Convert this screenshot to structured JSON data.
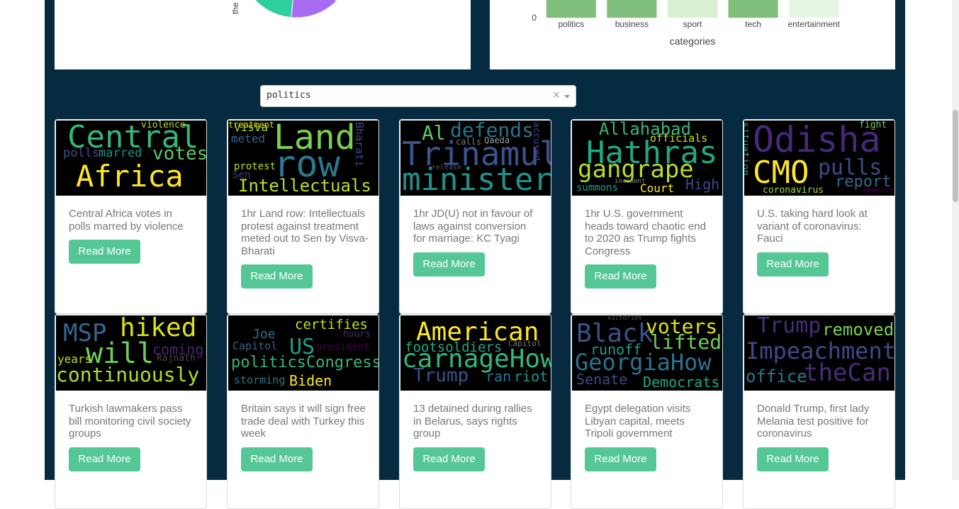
{
  "bar_chart": {
    "type": "bar",
    "categories": [
      "politics",
      "business",
      "sport",
      "tech",
      "entertainment"
    ],
    "values": [
      230,
      225,
      228,
      90,
      75
    ],
    "ylim": [
      0,
      250
    ],
    "y_tick_visible": "0",
    "xlabel": "categories",
    "colors": [
      "#7fbf7b",
      "#7fbf7b",
      "#d9f0d3",
      "#7fbf7b",
      "#e7f5e4"
    ]
  },
  "pie_chart": {
    "visible_slice_label": "the",
    "slice_colors": [
      "#2dcf9c",
      "#a86cf2",
      "#6f76f0"
    ]
  },
  "dropdown": {
    "value": "politics",
    "clear": "×"
  },
  "cards": [
    {
      "title": "Central Africa votes in polls marred by violence",
      "button": "Read More",
      "words": [
        {
          "t": "Central",
          "c": "#35b779"
        },
        {
          "t": "Africa",
          "c": "#fde725"
        },
        {
          "t": "votes",
          "c": "#5ec962"
        },
        {
          "t": "polls",
          "c": "#3b528b"
        },
        {
          "t": "marred",
          "c": "#21918c"
        },
        {
          "t": "violence",
          "c": "#b5de2b"
        }
      ]
    },
    {
      "title": "1hr Land row: Intellectuals protest against treatment meted out to Sen by Visva-Bharati",
      "button": "Read More",
      "words": [
        {
          "t": "Land",
          "c": "#7ad151"
        },
        {
          "t": "row",
          "c": "#2a788e"
        },
        {
          "t": "Intellectuals",
          "c": "#bddf26"
        },
        {
          "t": "Visva",
          "c": "#a0da39"
        },
        {
          "t": "meted",
          "c": "#31688e"
        },
        {
          "t": "protest",
          "c": "#b5de2b"
        },
        {
          "t": "Sen",
          "c": "#443983"
        },
        {
          "t": "Bharati",
          "c": "#414487"
        },
        {
          "t": "treatment",
          "c": "#d2e21b"
        }
      ]
    },
    {
      "title": "1hr JD(U) not in favour of laws against conversion for marriage: KC Tyagi",
      "button": "Read More",
      "words": [
        {
          "t": "Trinamul",
          "c": "#3b528b"
        },
        {
          "t": "minister",
          "c": "#21918c"
        },
        {
          "t": "defends",
          "c": "#2c728e"
        },
        {
          "t": "Al",
          "c": "#5ec962"
        },
        {
          "t": "Qaeda",
          "c": "#9c9c9c"
        },
        {
          "t": "calls",
          "c": "#7a7a7a"
        },
        {
          "t": "release",
          "c": "#555"
        },
        {
          "t": "accused",
          "c": "#3e4a89"
        }
      ]
    },
    {
      "title": "1hr U.S. government heads toward chaotic end to 2020 as Trump fights Congress",
      "button": "Read More",
      "words": [
        {
          "t": "Hathras",
          "c": "#22a884"
        },
        {
          "t": "gangrape",
          "c": "#b5de2b"
        },
        {
          "t": "Allahabad",
          "c": "#35b779"
        },
        {
          "t": "officials",
          "c": "#c8e020"
        },
        {
          "t": "summons",
          "c": "#1f9e89"
        },
        {
          "t": "incident",
          "c": "#888"
        },
        {
          "t": "Court",
          "c": "#fde725"
        },
        {
          "t": "High",
          "c": "#3e4989"
        }
      ]
    },
    {
      "title": "U.S. taking hard look at variant of coronavirus: Fauci",
      "button": "Read More",
      "words": [
        {
          "t": "Odisha",
          "c": "#482878"
        },
        {
          "t": "CMO",
          "c": "#fde725"
        },
        {
          "t": "pulls",
          "c": "#3e4a89"
        },
        {
          "t": "report",
          "c": "#31688e"
        },
        {
          "t": "fight",
          "c": "#6ece58"
        },
        {
          "t": "situation",
          "c": "#1f9e89"
        },
        {
          "t": "coronavirus",
          "c": "#a0da39"
        },
        {
          "t": "Opposition",
          "c": "#440154"
        }
      ]
    },
    {
      "title": "Turkish lawmakers pass bill monitoring civil society groups",
      "button": "Read More",
      "words": [
        {
          "t": "MSP",
          "c": "#31688e"
        },
        {
          "t": "hiked",
          "c": "#dce319"
        },
        {
          "t": "will",
          "c": "#6ece58"
        },
        {
          "t": "coming",
          "c": "#482475"
        },
        {
          "t": "years",
          "c": "#c2df23"
        },
        {
          "t": "Rajnath",
          "c": "#4a4a4a"
        },
        {
          "t": "continuously",
          "c": "#addc30"
        }
      ]
    },
    {
      "title": "Britain says it will sign free trade deal with Turkey this week",
      "button": "Read More",
      "words": [
        {
          "t": "certifies",
          "c": "#c2df23"
        },
        {
          "t": "Joe",
          "c": "#2c728e"
        },
        {
          "t": "hours",
          "c": "#482878"
        },
        {
          "t": "Capitol",
          "c": "#33638d"
        },
        {
          "t": "US",
          "c": "#1f9e89"
        },
        {
          "t": "president",
          "c": "#440154"
        },
        {
          "t": "politicsCongress",
          "c": "#35b779"
        },
        {
          "t": "storming",
          "c": "#2a788e"
        },
        {
          "t": "Biden",
          "c": "#fde725"
        }
      ]
    },
    {
      "title": "13 detained during rallies in Belarus, says rights group",
      "button": "Read More",
      "words": [
        {
          "t": "American",
          "c": "#fde725"
        },
        {
          "t": "footsoldiers",
          "c": "#22a884"
        },
        {
          "t": "Capitol",
          "c": "#7a7a7a"
        },
        {
          "t": "carnageHow",
          "c": "#35b779"
        },
        {
          "t": "Trump",
          "c": "#3b528b"
        },
        {
          "t": "ran",
          "c": "#2c728e"
        },
        {
          "t": "riot",
          "c": "#21918c"
        }
      ]
    },
    {
      "title": "Egypt delegation visits Libyan capital, meets Tripoli government",
      "button": "Read More",
      "words": [
        {
          "t": "victories",
          "c": "#555"
        },
        {
          "t": "Black",
          "c": "#3b528b"
        },
        {
          "t": "voters",
          "c": "#dce319"
        },
        {
          "t": "lifted",
          "c": "#6ece58"
        },
        {
          "t": "runoff",
          "c": "#1f9e89"
        },
        {
          "t": "GeorgiaHow",
          "c": "#2c728e"
        },
        {
          "t": "Senate",
          "c": "#3e4a89"
        },
        {
          "t": "Democrats",
          "c": "#22a884"
        }
      ]
    },
    {
      "title": "Donald Trump, first lady Melania test positive for coronavirus",
      "button": "Read More",
      "words": [
        {
          "t": "Trump",
          "c": "#472d7b"
        },
        {
          "t": "removed",
          "c": "#7ad151"
        },
        {
          "t": "Impeachment",
          "c": "#3e4a89"
        },
        {
          "t": "office",
          "c": "#2a788e"
        },
        {
          "t": "theCan",
          "c": "#472d7b"
        }
      ]
    }
  ]
}
